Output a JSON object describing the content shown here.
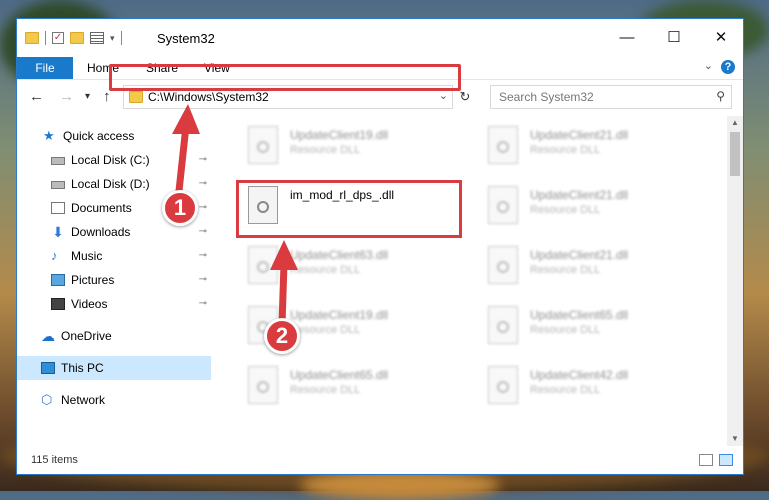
{
  "window": {
    "title": "System32",
    "controls": {
      "minimize": "—",
      "maximize": "☐",
      "close": "✕"
    }
  },
  "ribbon": {
    "tabs": [
      "File",
      "Home",
      "Share",
      "View"
    ],
    "help": "?",
    "collapse": "⌄"
  },
  "navbar": {
    "address": "C:\\Windows\\System32",
    "search_placeholder": "Search System32"
  },
  "sidebar": {
    "items": [
      {
        "label": "Quick access",
        "icon": "star-icon"
      },
      {
        "label": "Local Disk (C:)",
        "icon": "drive-icon",
        "pinned": true
      },
      {
        "label": "Local Disk (D:)",
        "icon": "drive-icon",
        "pinned": true
      },
      {
        "label": "Documents",
        "icon": "documents-icon",
        "pinned": true
      },
      {
        "label": "Downloads",
        "icon": "downloads-icon",
        "pinned": true
      },
      {
        "label": "Music",
        "icon": "music-icon",
        "pinned": true
      },
      {
        "label": "Pictures",
        "icon": "pictures-icon",
        "pinned": true
      },
      {
        "label": "Videos",
        "icon": "videos-icon",
        "pinned": true
      },
      {
        "label": "OneDrive",
        "icon": "onedrive-icon"
      },
      {
        "label": "This PC",
        "icon": "this-pc-icon",
        "selected": true
      },
      {
        "label": "Network",
        "icon": "network-icon"
      }
    ],
    "pin_glyph": "📌"
  },
  "files": [
    {
      "name": "UpdateClient19.dll",
      "type": "Resource DLL"
    },
    {
      "name": "UpdateClient21.dll",
      "type": "Resource DLL"
    },
    {
      "name": "im_mod_rl_dps_.dll",
      "type": ""
    },
    {
      "name": "UpdateClient21.dll",
      "type": "Resource DLL"
    },
    {
      "name": "UpdateClient63.dll",
      "type": "Resource DLL"
    },
    {
      "name": "UpdateClient21.dll",
      "type": "Resource DLL"
    },
    {
      "name": "UpdateClient19.dll",
      "type": "Resource DLL"
    },
    {
      "name": "UpdateClient65.dll",
      "type": "Resource DLL"
    },
    {
      "name": "UpdateClient65.dll",
      "type": "Resource DLL"
    },
    {
      "name": "UpdateClient42.dll",
      "type": "Resource DLL"
    }
  ],
  "status": {
    "item_count": "115 items"
  },
  "annotations": {
    "step1": "1",
    "step2": "2",
    "highlight_color": "#d93b3f"
  },
  "colors": {
    "accent": "#1979ca",
    "selection": "#cce8ff"
  }
}
